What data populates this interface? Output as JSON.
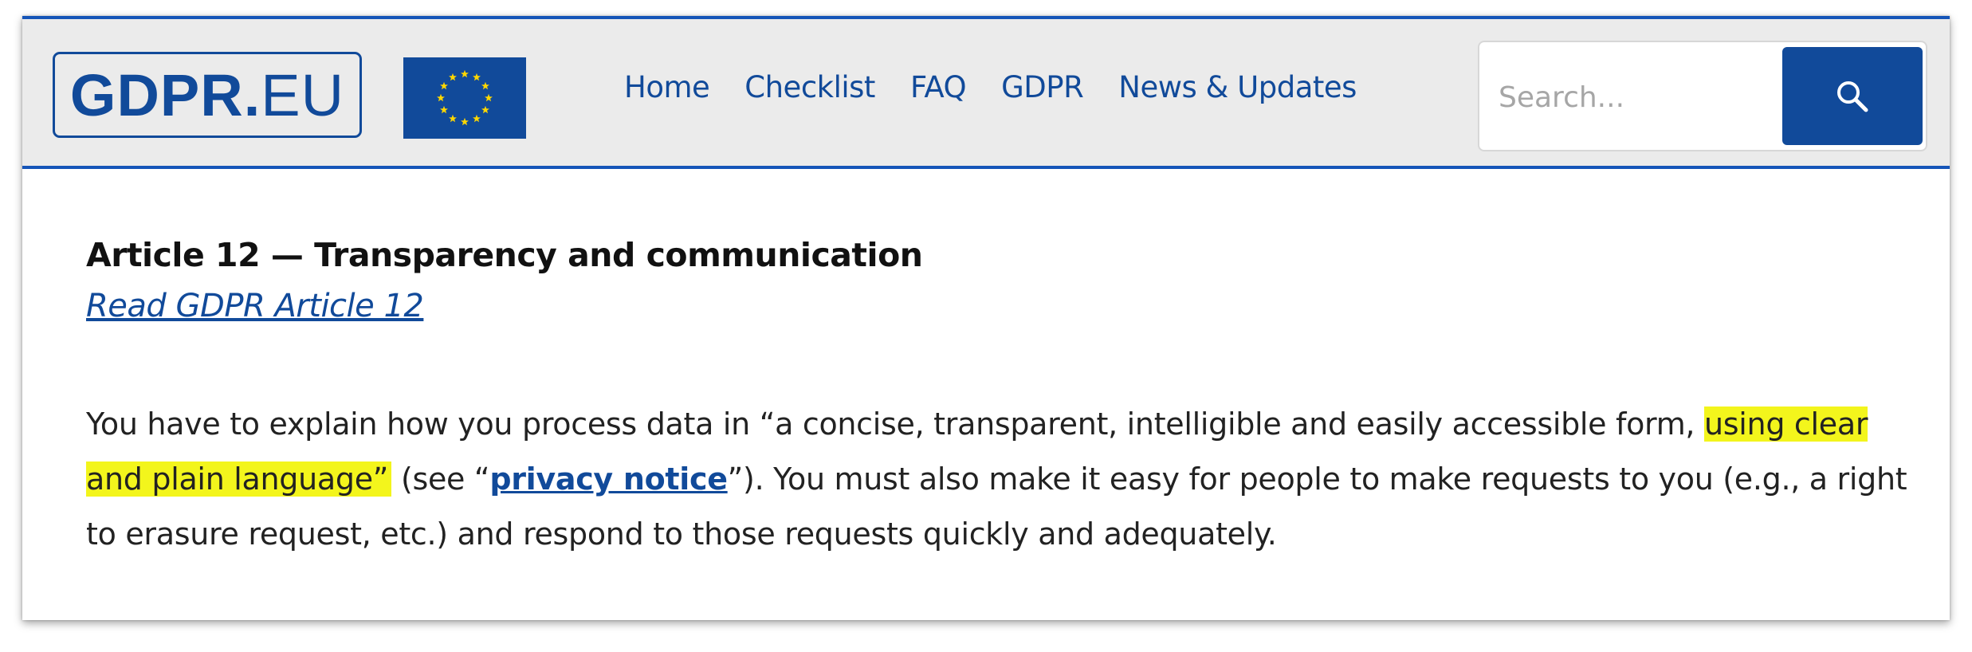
{
  "header": {
    "logo": {
      "bold": "GDPR.",
      "light": "EU"
    },
    "nav": [
      {
        "label": "Home"
      },
      {
        "label": "Checklist"
      },
      {
        "label": "FAQ"
      },
      {
        "label": "GDPR"
      },
      {
        "label": "News & Updates"
      }
    ],
    "search": {
      "placeholder": "Search...",
      "icon": "search-icon"
    },
    "flag_icon": "eu-flag-icon"
  },
  "article": {
    "title": "Article 12 — Transparency and communication",
    "link_label": "Read GDPR Article 12",
    "paragraph": {
      "part1": "You have to explain how you process data in “a concise, transparent, intelligible and easily accessible form, ",
      "highlight": "using clear and plain language”",
      "part2": " (see “",
      "link": "privacy notice",
      "part3": "”). You must also make it easy for people to make requests to you (e.g., a right to erasure request, etc.) and respond to those requests quickly and adequately."
    }
  },
  "colors": {
    "brand_blue": "#114a9a",
    "accent_line": "#1555b8",
    "highlight": "#f3f51c",
    "header_bg": "#ebebeb",
    "flag_star": "#ffd700"
  }
}
